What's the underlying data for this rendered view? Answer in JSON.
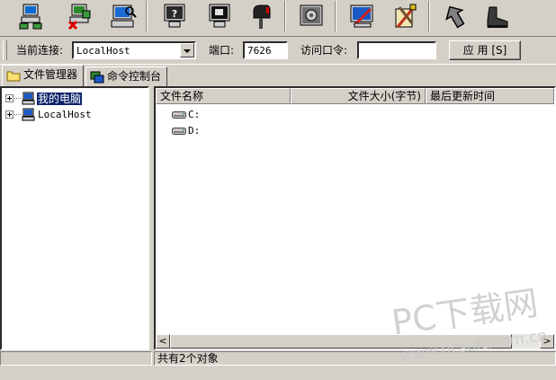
{
  "toolbar": {
    "buttons": [
      {
        "icon": "network-computer-icon"
      },
      {
        "icon": "disconnect-computer-icon"
      },
      {
        "icon": "search-computer-icon"
      },
      {
        "icon": "help-monitor-icon"
      },
      {
        "icon": "screen-monitor-icon"
      },
      {
        "icon": "mailbox-icon"
      },
      {
        "icon": "settings-gear-icon"
      },
      {
        "icon": "edit-screen-icon"
      },
      {
        "icon": "tools-config-icon"
      },
      {
        "icon": "up-arrow-icon"
      },
      {
        "icon": "boot-exit-icon"
      }
    ]
  },
  "connection": {
    "current_label": "当前连接:",
    "current_value": "LocalHost",
    "port_label": "端口:",
    "port_value": "7626",
    "password_label": "访问口令:",
    "password_value": "",
    "apply_label": "应 用 [S]"
  },
  "tabs": [
    {
      "label": "文件管理器",
      "icon": "folder-icon"
    },
    {
      "label": "命令控制台",
      "icon": "console-icon"
    }
  ],
  "tree": {
    "items": [
      {
        "label": "我的电脑",
        "selected": true
      },
      {
        "label": "LocalHost",
        "selected": false
      }
    ]
  },
  "file_list": {
    "columns": [
      "文件名称",
      "文件大小(字节)",
      "最后更新时间"
    ],
    "rows": [
      {
        "name": "C:"
      },
      {
        "name": "D:"
      }
    ]
  },
  "scrollbar": {
    "left_arrow": "<",
    "right_arrow": ">"
  },
  "status": {
    "text": "共有2个对象"
  },
  "watermark": {
    "line1": "PC下载网",
    "line2": "www.pcsoft.com.cn"
  },
  "colors": {
    "face": "#d4d0c8",
    "selection": "#0a246a",
    "window": "#ffffff"
  }
}
